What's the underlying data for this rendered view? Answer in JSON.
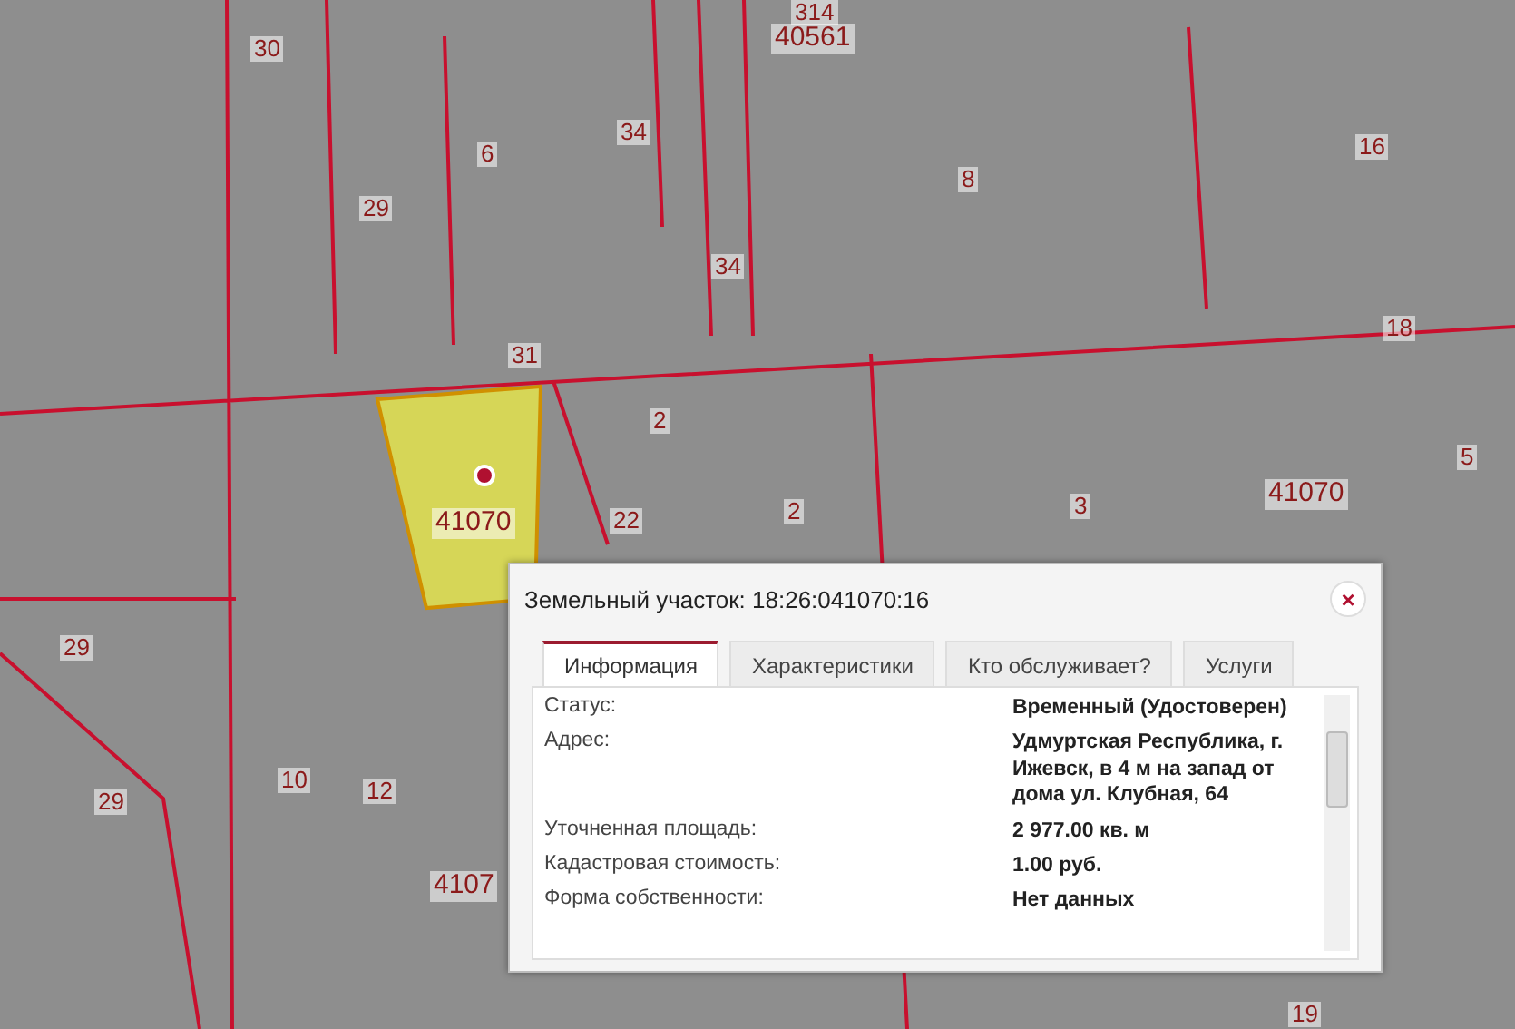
{
  "map": {
    "parcel_labels": [
      "314",
      "40561",
      "30",
      "6",
      "34",
      "29",
      "34",
      "8",
      "16",
      "31",
      "18",
      "2",
      "2",
      "41070",
      "22",
      "3",
      "41070",
      "5",
      "29",
      "29",
      "10",
      "12",
      "4107",
      "19"
    ]
  },
  "popup": {
    "title": "Земельный участок: 18:26:041070:16",
    "close": "×",
    "tabs": [
      {
        "label": "Информация",
        "selected": true
      },
      {
        "label": "Характеристики",
        "selected": false
      },
      {
        "label": "Кто обслуживает?",
        "selected": false
      },
      {
        "label": "Услуги",
        "selected": false
      }
    ],
    "fields": [
      {
        "label": "Статус:",
        "value": "Временный (Удостоверен)"
      },
      {
        "label": "Адрес:",
        "value": "Удмуртская Республика, г. Ижевск, в 4 м на запад от дома ул. Клубная, 64"
      },
      {
        "label": "Уточненная площадь:",
        "value": "2 977.00 кв. м"
      },
      {
        "label": "Кадастровая стоимость:",
        "value": "1.00 руб."
      },
      {
        "label": "Форма собственности:",
        "value": "Нет данных"
      }
    ]
  }
}
